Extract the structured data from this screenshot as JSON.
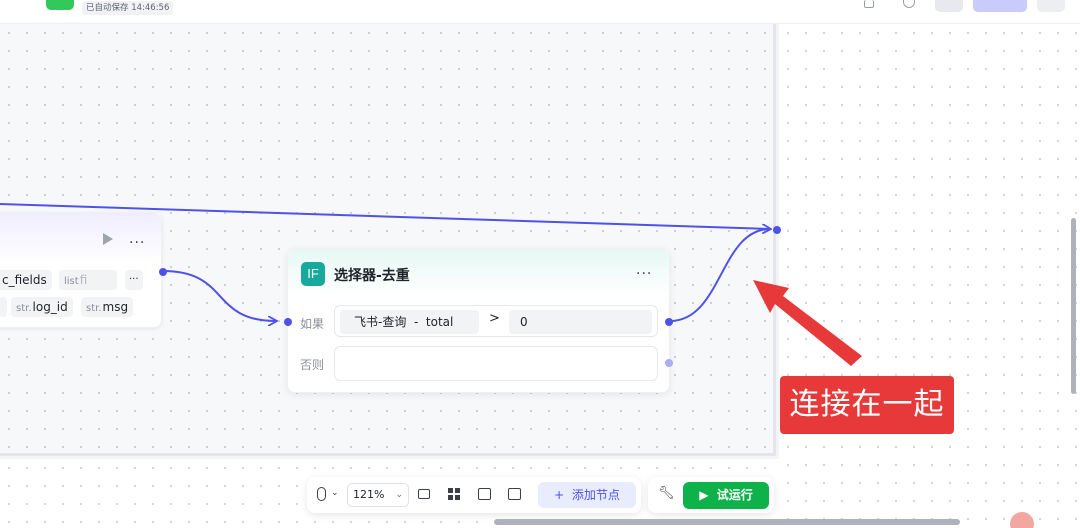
{
  "header": {
    "save_status": "已自动保存 14:46:56"
  },
  "left_node": {
    "fields_top": [
      {
        "name": "c_fields"
      },
      {
        "type": "list",
        "name": "fi"
      }
    ],
    "more_badge": "···",
    "fields_bottom": [
      {
        "type": "str.",
        "name": "log_id"
      },
      {
        "type": "str.",
        "name": "msg"
      }
    ]
  },
  "if_node": {
    "icon_text": "IF",
    "title": "选择器-去重",
    "more": "···",
    "if_label": "如果",
    "condition": {
      "left": "飞书-查询  -  total",
      "operator": ">",
      "right": "0"
    },
    "else_label": "否则"
  },
  "annotation": {
    "text": "连接在一起",
    "color": "#e8393a"
  },
  "toolbar": {
    "zoom": "121%",
    "add_node_label": "添加节点",
    "add_node_plus": "+"
  },
  "run": {
    "label": "试运行",
    "color": "#0fb14a"
  },
  "colors": {
    "edge": "#4d53e8",
    "accent": "#4d53e8"
  }
}
